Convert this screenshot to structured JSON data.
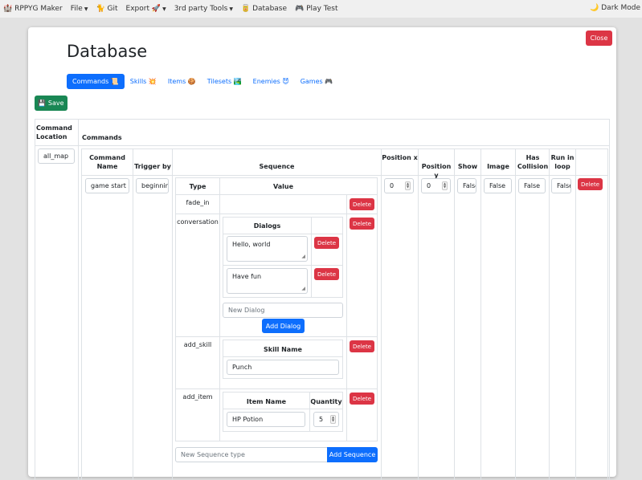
{
  "navbar": {
    "brand": "RPPYG Maker",
    "brand_icon": "castle-icon",
    "items": [
      {
        "label": "File",
        "dropdown": true,
        "icon": ""
      },
      {
        "label": "Git",
        "dropdown": false,
        "icon": "🐈"
      },
      {
        "label": "Export 🚀",
        "dropdown": true,
        "icon": ""
      },
      {
        "label": "3rd party Tools",
        "dropdown": true,
        "icon": ""
      },
      {
        "label": "Database",
        "dropdown": false,
        "icon": "🥫"
      },
      {
        "label": "Play Test",
        "dropdown": false,
        "icon": "🎮"
      }
    ],
    "dark_mode": "🌙 Dark Mode",
    "brand_emoji": "🏰"
  },
  "modal": {
    "close_label": "Close",
    "title": "Database",
    "tabs": [
      {
        "label": "Commands 📜",
        "active": true
      },
      {
        "label": "Skills 💥",
        "active": false
      },
      {
        "label": "Items 🍪",
        "active": false
      },
      {
        "label": "Tilesets 🏞️",
        "active": false
      },
      {
        "label": "Enemies 😈",
        "active": false
      },
      {
        "label": "Games 🎮",
        "active": false
      }
    ],
    "save_label": "💾 Save"
  },
  "outer_table": {
    "headers": {
      "location": "Command Location",
      "commands": "Commands"
    },
    "location_value": "all_map"
  },
  "commands_table": {
    "headers": {
      "name": "Command Name",
      "trigger": "Trigger by",
      "sequence": "Sequence",
      "pos_x": "Position x",
      "pos_y": "Position y",
      "show": "Show",
      "image": "Image",
      "collision": "Has Collision",
      "loop": "Run in loop"
    },
    "row": {
      "name": "game start",
      "trigger": "beginning",
      "pos_x": "0",
      "pos_y": "0",
      "show": "False",
      "image": "False",
      "collision": "False",
      "loop": "False",
      "delete_label": "Delete"
    }
  },
  "sequence": {
    "headers": {
      "type": "Type",
      "value": "Value"
    },
    "delete_label": "Delete",
    "items": [
      {
        "type": "fade_in"
      },
      {
        "type": "conversation",
        "dialogs_header": "Dialogs",
        "dialogs": [
          "Hello, world",
          "Have fun"
        ],
        "new_dialog_placeholder": "New Dialog",
        "add_dialog_label": "Add Dialog"
      },
      {
        "type": "add_skill",
        "skill_header": "Skill Name",
        "skill_value": "Punch"
      },
      {
        "type": "add_item",
        "item_header": "Item Name",
        "quantity_header": "Quantity",
        "item_value": "HP Potion",
        "quantity_value": "5"
      }
    ],
    "new_sequence_placeholder": "New Sequence type",
    "add_sequence_label": "Add Sequence"
  }
}
